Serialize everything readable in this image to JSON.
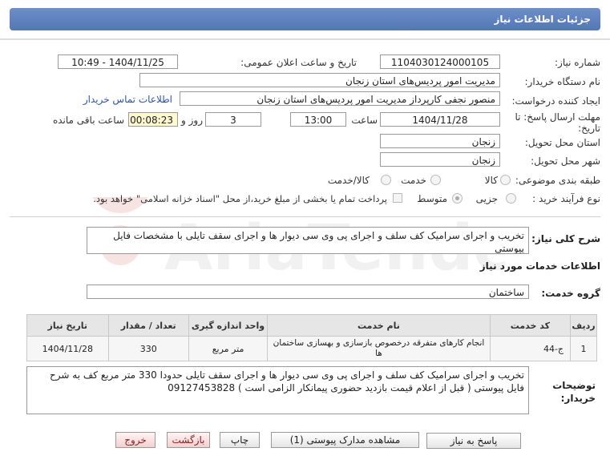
{
  "header": {
    "title": "جزئیات اطلاعات نیاز"
  },
  "fields": {
    "need_number_label": "شماره نیاز:",
    "need_number": "1104030124000105",
    "announce_label": "تاریخ و ساعت اعلان عمومی:",
    "announce_value": "1404/11/25 - 10:49",
    "buyer_label": "نام دستگاه خریدار:",
    "buyer_value": "مدیریت امور پردیس‌های استان زنجان",
    "creator_label": "ایجاد کننده درخواست:",
    "creator_value": "منصور نجفی کارپرداز  مدیریت امور پردیس‌های استان زنجان",
    "contact_link": "اطلاعات تماس خریدار",
    "deadline_label_1": "مهلت ارسال پاسخ: تا",
    "deadline_label_2": "تاریخ:",
    "deadline_date": "1404/11/28",
    "time_label": "ساعت",
    "deadline_time": "13:00",
    "days_value": "3",
    "days_label": "روز و",
    "remaining_time": "00:08:23",
    "remaining_label": "ساعت باقی مانده",
    "province_label": "استان محل تحویل:",
    "province_value": "زنجان",
    "city_label": "شهر محل تحویل:",
    "city_value": "زنجان",
    "category_label": "طبقه بندی موضوعی:",
    "category_options": [
      "کالا",
      "خدمت",
      "کالا/خدمت"
    ],
    "process_label": "نوع فرآیند خرید :",
    "process_options": [
      "جزیی",
      "متوسط"
    ],
    "payment_note": "پرداخت تمام یا بخشی از مبلغ خرید،از محل \"اسناد خزانه اسلامی\" خواهد بود."
  },
  "summary": {
    "label": "شرح کلی نیاز:",
    "text": "تخریب و اجرای سرامیک کف سلف و اجرای پی وی سی دیوار ها و اجرای سقف تایلی با مشخصات فایل پیوستی"
  },
  "services": {
    "section_title": "اطلاعات خدمات مورد نیاز",
    "group_label": "گروه خدمت:",
    "group_value": "ساختمان",
    "columns": [
      "ردیف",
      "کد خدمت",
      "نام خدمت",
      "واحد اندازه گیری",
      "تعداد / مقدار",
      "تاریخ نیاز"
    ],
    "rows": [
      {
        "index": "1",
        "code": "ج-44",
        "name": "انجام کارهای متفرقه درخصوص بازسازی و بهسازی ساختمان ها",
        "unit": "متر مربع",
        "qty": "330",
        "date": "1404/11/28"
      }
    ]
  },
  "description": {
    "label_1": "توضیحات",
    "label_2": "خریدار:",
    "text": "تخریب و اجرای سرامیک کف سلف و اجرای پی وی سی دیوار ها و اجرای سقف تایلی حدودا 330 متر مربع کف به شرح  فایل پیوستی ( قبل از اعلام قیمت بازدید حضوری پیمانکار الزامی است ) 09127453828"
  },
  "buttons": {
    "reply": "پاسخ به نیاز",
    "attachments": "مشاهده مدارک پیوستی (1)",
    "print": "چاپ",
    "back": "بازگشت",
    "exit": "خروج"
  },
  "watermark": {
    "text": "AriaTender.net"
  }
}
